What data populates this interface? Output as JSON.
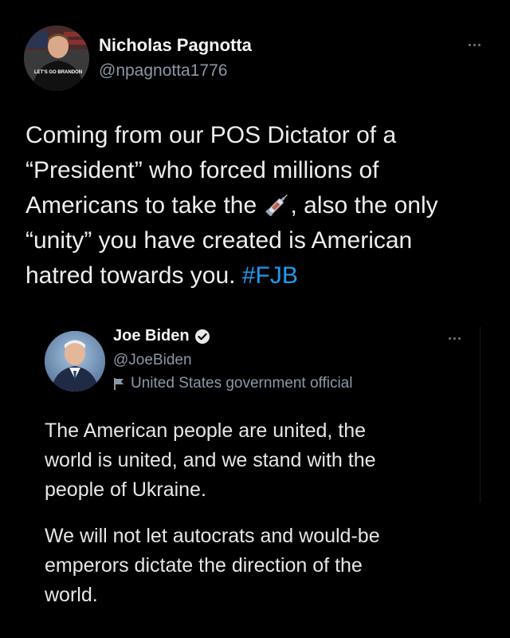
{
  "tweet": {
    "author_name": "Nicholas Pagnotta",
    "handle": "@npagnotta1776",
    "avatar_icon": "profile-photo-icon",
    "avatar_shirt_text": "LET'S GO BRANDON",
    "more_icon": "more-options-icon",
    "text_lines": [
      "Coming from our POS Dictator of a",
      "“President” who forced millions of",
      "Americans to take the",
      ", also the only",
      "“unity” you have created is American",
      "hatred towards you."
    ],
    "hashtag": "#FJB",
    "emoji_icon": "syringe-icon"
  },
  "quoted_tweet": {
    "author_name": "Joe Biden",
    "verified_icon": "verified-badge-icon",
    "handle": "@JoeBiden",
    "label_icon": "flag-icon",
    "label": "United States government official",
    "more_icon": "more-options-icon",
    "paragraph1_lines": [
      "The American people are united, the",
      "world is united, and we stand with the",
      "people of Ukraine."
    ],
    "paragraph2_lines": [
      "We will not let autocrats and would-be",
      "emperors dictate the direction of the",
      "world."
    ]
  },
  "colors": {
    "background": "#000000",
    "text": "#e7e9ea",
    "secondary": "#8b98a5",
    "link": "#1d9bf0"
  }
}
